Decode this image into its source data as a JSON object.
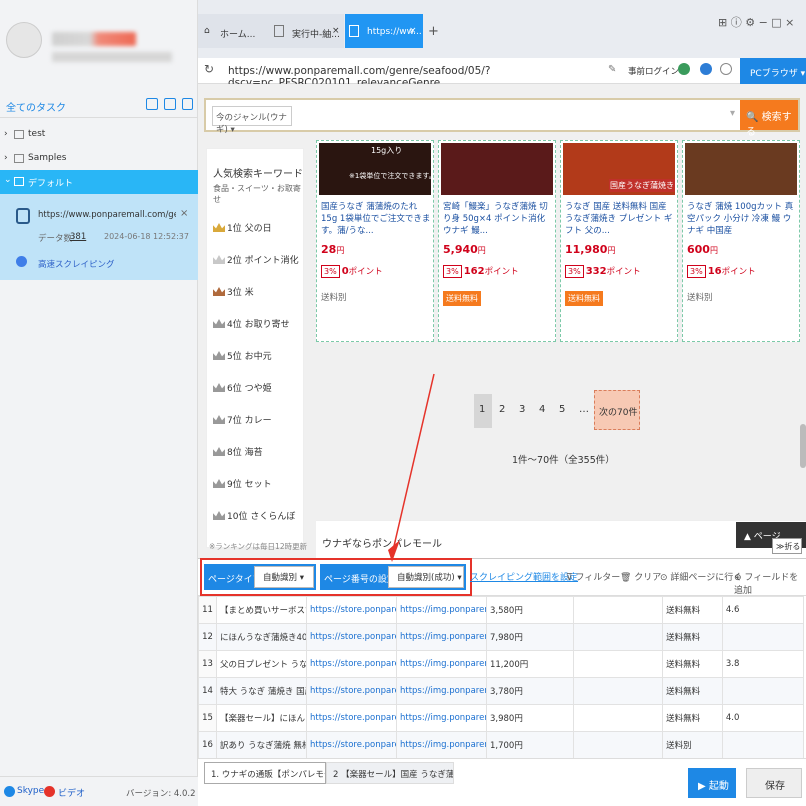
{
  "sidebar": {
    "tasks_title": "全てのタスク",
    "folders": [
      "test",
      "Samples"
    ],
    "selected_folder": "デフォルト",
    "task": {
      "url": "https://www.ponparemall.com/ge-スクレイ...",
      "data_label": "データ数:",
      "data_count": "381",
      "date": "2024-06-18 12:52:37",
      "mode": "高速スクレイピング"
    },
    "bottom": {
      "skype": "Skype",
      "video": "ビデオ",
      "version": "バージョン: 4.0.2"
    }
  },
  "tabs": [
    {
      "label": "ホーム..."
    },
    {
      "label": "実行中-紬..."
    },
    {
      "label": "https://ww..."
    }
  ],
  "address": {
    "url": "https://www.ponparemall.com/genre/seafood/05/?dscv=pc_PFSRC020101_relevanceGenre",
    "login": "事前ログイン",
    "browser": "PCブラウザ"
  },
  "web": {
    "genre": "今のジャンル(ウナギ)",
    "search_btn": "検索する",
    "rank_title": "人気検索キーワード",
    "rank_sub": "食品・スイーツ・お取寄せ",
    "ranks": [
      {
        "pos": "1位",
        "kw": "父の日",
        "color": "#d9a93b"
      },
      {
        "pos": "2位",
        "kw": "ポイント消化",
        "color": "#c8c8c8"
      },
      {
        "pos": "3位",
        "kw": "米",
        "color": "#b06a3c"
      },
      {
        "pos": "4位",
        "kw": "お取り寄せ",
        "color": "#999999"
      },
      {
        "pos": "5位",
        "kw": "お中元",
        "color": "#999999"
      },
      {
        "pos": "6位",
        "kw": "つや姫",
        "color": "#999999"
      },
      {
        "pos": "7位",
        "kw": "カレー",
        "color": "#999999"
      },
      {
        "pos": "8位",
        "kw": "海苔",
        "color": "#999999"
      },
      {
        "pos": "9位",
        "kw": "セット",
        "color": "#999999"
      },
      {
        "pos": "10位",
        "kw": "さくらんぼ",
        "color": "#999999"
      }
    ],
    "rank_note": "※ランキングは毎日12時更新",
    "products": [
      {
        "title": "国産うなぎ 蒲蒲焼のたれ15g 1袋単位でご注文できます。蒲/うな...",
        "price": "28",
        "yen": "円",
        "pct": "3%",
        "points": "0",
        "pt_label": "ポイント",
        "ship": "送料別"
      },
      {
        "title": "宮崎「鰻楽」うなぎ蒲焼 切り身 50g×4 ポイント消化 ウナギ 鰻...",
        "price": "5,940",
        "yen": "円",
        "pct": "3%",
        "points": "162",
        "pt_label": "ポイント",
        "ship": "送料無料"
      },
      {
        "title": "うなぎ 国産 送料無料 国産うなぎ蒲焼き プレゼント ギフト 父の...",
        "price": "11,980",
        "yen": "円",
        "pct": "3%",
        "points": "332",
        "pt_label": "ポイント",
        "ship": "送料無料"
      },
      {
        "title": "うなぎ 蒲焼 100gカット 真空パック 小分け 冷凍 鰻 ウナギ 中国産",
        "price": "600",
        "yen": "円",
        "pct": "3%",
        "points": "16",
        "pt_label": "ポイント",
        "ship": "送料別"
      }
    ],
    "img_text1": "15g入り",
    "img_text2": "※1袋単位で注文できます。",
    "img_text3": "国産うなぎ蒲焼き",
    "pages": [
      "1",
      "2",
      "3",
      "4",
      "5",
      "…"
    ],
    "next": "次の70件",
    "count": "1件〜70件（全355件）",
    "unagi": "ウナギならポンパレモール",
    "page_top": "ページ",
    "fold": "折る"
  },
  "toolbar": {
    "page_type": "ページタイプ",
    "page_type_val": "自動識別",
    "page_num": "ページ番号の設定",
    "page_num_val": "自動識別(成功)",
    "range": "スクレイピング範囲を設定",
    "filter": "フィルター",
    "clear": "クリア",
    "detail": "詳細ページに行く",
    "add_field": "フィールドを追加"
  },
  "rows": [
    [
      "11",
      "【まとめ買いサーボスで...",
      "https://store.ponparemall...",
      "https://img.ponparemall.n...",
      "3,580円",
      "送料無料",
      "4.6"
    ],
    [
      "12",
      "にほんうなぎ蒲焼き400g...",
      "https://store.ponparemall...",
      "https://img.ponparemall.n...",
      "7,980円",
      "送料無料",
      ""
    ],
    [
      "13",
      "父の日プレゼント うなぎ...",
      "https://store.ponparemall...",
      "https://img.ponparemall.n...",
      "11,200円",
      "送料無料",
      "3.8"
    ],
    [
      "14",
      "特大 うなぎ 蒲焼き 国産...",
      "https://store.ponparemall...",
      "https://img.ponparemall.n...",
      "3,780円",
      "送料無料",
      ""
    ],
    [
      "15",
      "【楽器セール】にほんう...",
      "https://store.ponparemall...",
      "https://img.ponparemall.n...",
      "3,980円",
      "送料無料",
      "4.0"
    ],
    [
      "16",
      "訳あり うなぎ蒲焼 無材5...",
      "https://store.ponparemall...",
      "https://img.ponparemall.n...",
      "1,700円",
      "送料別",
      ""
    ]
  ],
  "bottom": {
    "tab1": "1. ウナギの通販【ポンパレモール】",
    "tab2": "2 【楽器セール】国産 うなぎ蒲焼...",
    "start": "起動",
    "save": "保存"
  }
}
